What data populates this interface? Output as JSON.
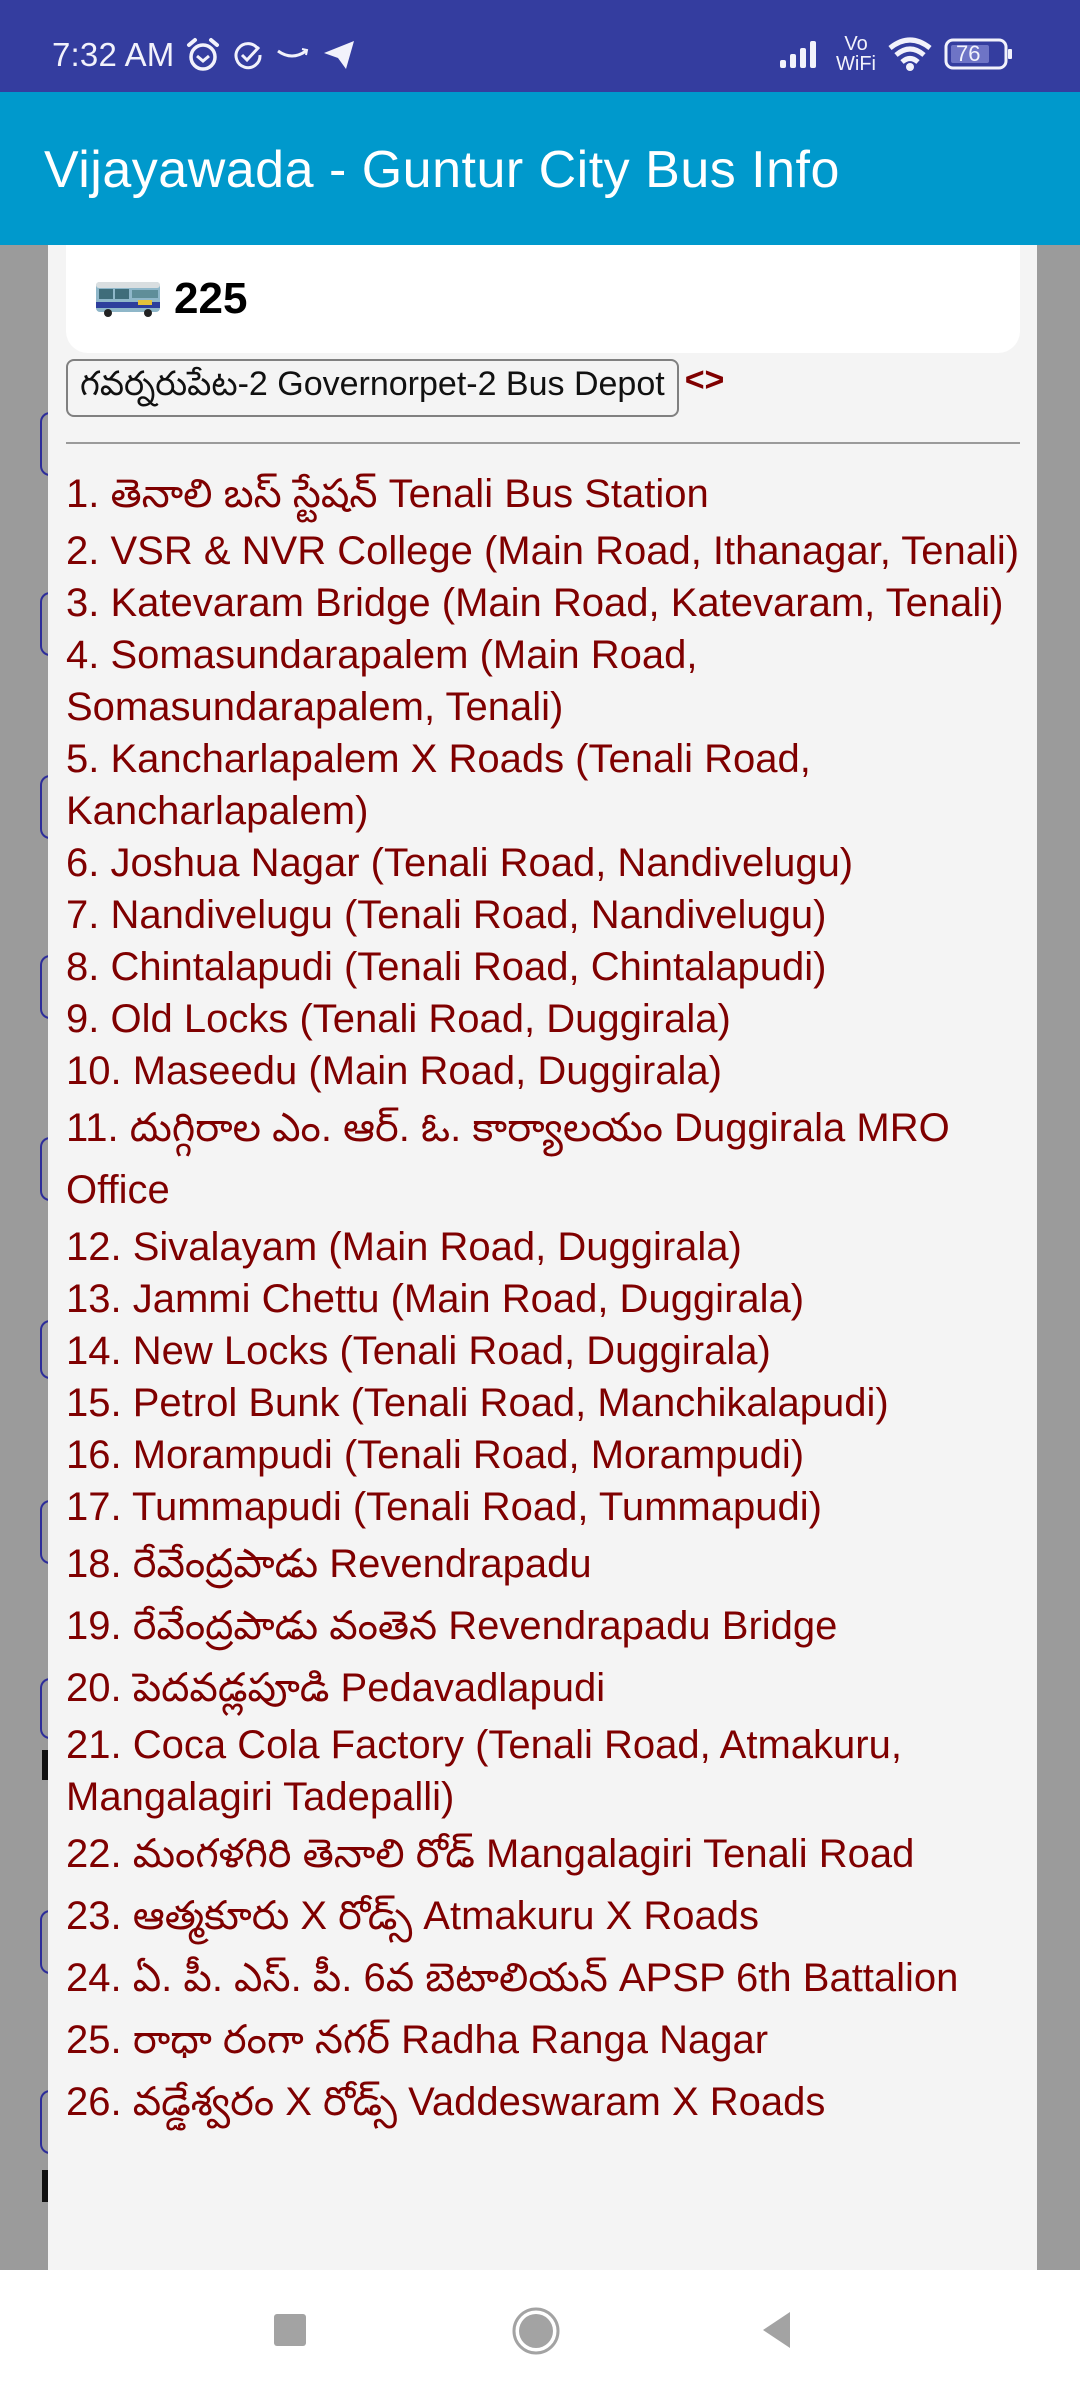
{
  "status_bar": {
    "time": "7:32 AM",
    "left_icons": [
      "alarm-icon",
      "check-circle-icon",
      "amazon-icon",
      "telegram-icon"
    ],
    "right_icons": [
      "signal-icon",
      "vowifi-icon",
      "wifi-icon",
      "battery-icon"
    ],
    "vowifi_top": "Vo",
    "vowifi_bottom": "WiFi",
    "battery": "76"
  },
  "app_bar": {
    "title": "Vijayawada - Guntur City Bus Info"
  },
  "route": {
    "icon": "bus-icon",
    "number": "225",
    "depot_button": "గవర్నరుపేట-2 Governorpet-2 Bus Depot",
    "nav_arrows": "<>"
  },
  "stops": [
    "1. తెనాలి బస్ స్టేషన్ Tenali Bus Station",
    "2. VSR & NVR College (Main Road, Ithanagar, Tenali)",
    "3. Katevaram Bridge (Main Road, Katevaram, Tenali)",
    "4. Somasundarapalem (Main Road, Somasundarapalem, Tenali)",
    "5. Kancharlapalem X Roads (Tenali Road, Kancharlapalem)",
    "6. Joshua Nagar (Tenali Road, Nandivelugu)",
    "7. Nandivelugu (Tenali Road, Nandivelugu)",
    "8. Chintalapudi (Tenali Road, Chintalapudi)",
    "9. Old Locks (Tenali Road, Duggirala)",
    "10. Maseedu (Main Road, Duggirala)",
    "11. దుగ్గిరాల ఎం. ఆర్. ఓ. కార్యాలయం Duggirala MRO Office",
    "12. Sivalayam (Main Road, Duggirala)",
    "13. Jammi Chettu (Main Road, Duggirala)",
    "14. New Locks (Tenali Road, Duggirala)",
    "15. Petrol Bunk (Tenali Road, Manchikalapudi)",
    "16. Morampudi (Tenali Road, Morampudi)",
    "17. Tummapudi (Tenali Road, Tummapudi)",
    "18. రేవేంద్రపాడు Revendrapadu",
    "19. రేవేంద్రపాడు వంతెన Revendrapadu Bridge",
    "20. పెదవడ్లపూడి Pedavadlapudi",
    "21. Coca Cola Factory (Tenali Road, Atmakuru, Mangalagiri Tadepalli)",
    "22. మంగళగిరి తెనాలి రోడ్ Mangalagiri Tenali Road",
    "23. ఆత్మకూరు X రోడ్స్ Atmakuru X Roads",
    "24. ఏ. పీ. ఎస్. పీ. 6వ బెటాలియన్ APSP 6th Battalion",
    "25. రాధా రంగా నగర్ Radha Ranga Nagar",
    "26. వడ్డేశ్వరం X రోడ్స్ Vaddeswaram X Roads"
  ],
  "nav_bar": {
    "buttons": [
      "recents-button",
      "home-button",
      "back-button"
    ]
  },
  "colors": {
    "status_bar": "#343d9f",
    "app_bar": "#0099cc",
    "stop_text": "#7f0000",
    "panel": "#f4f4f4",
    "backdrop": "#9b9b9b"
  }
}
